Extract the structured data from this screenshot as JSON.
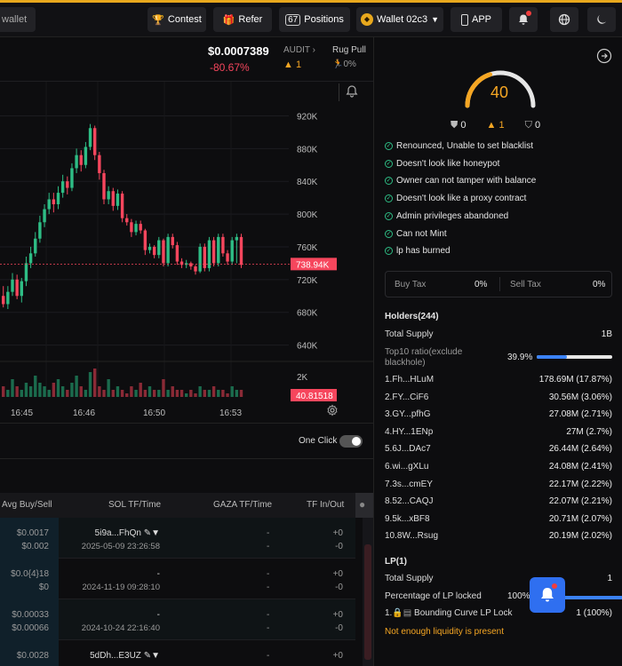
{
  "header": {
    "left_partial": "wallet",
    "contest": "Contest",
    "refer": "Refer",
    "positions_count": "67",
    "positions": "Positions",
    "wallet": "Wallet 02c3",
    "app": "APP",
    "contest_icon": "trophy-icon",
    "refer_icon": "gift-icon",
    "wallet_icon": "wallet-avatar-icon"
  },
  "price": {
    "value": "$0.0007389",
    "change": "-80.67%",
    "audit_label": "AUDIT",
    "audit_count": "1",
    "rugpull_label": "Rug Pull",
    "rugpull_value": "0%"
  },
  "chart_data": {
    "type": "candlestick",
    "y_ticks": [
      "920K",
      "880K",
      "840K",
      "800K",
      "760K",
      "720K",
      "680K",
      "640K"
    ],
    "ylim": [
      620000,
      940000
    ],
    "x_ticks": [
      "16:45",
      "16:46",
      "16:50",
      "16:53"
    ],
    "current_price_label": "738.94K",
    "current_price": 738940,
    "volume_tick": "2K",
    "volume_label": "40.81518",
    "candles": [
      [
        700000,
        690000,
        712000,
        686000
      ],
      [
        690000,
        705000,
        712000,
        684000
      ],
      [
        705000,
        720000,
        728000,
        700000
      ],
      [
        720000,
        700000,
        726000,
        696000
      ],
      [
        700000,
        718000,
        722000,
        692000
      ],
      [
        718000,
        740000,
        748000,
        712000
      ],
      [
        740000,
        752000,
        760000,
        734000
      ],
      [
        752000,
        770000,
        778000,
        748000
      ],
      [
        770000,
        790000,
        798000,
        765000
      ],
      [
        790000,
        806000,
        812000,
        784000
      ],
      [
        806000,
        818000,
        826000,
        800000
      ],
      [
        818000,
        812000,
        826000,
        802000
      ],
      [
        812000,
        826000,
        834000,
        806000
      ],
      [
        826000,
        840000,
        848000,
        820000
      ],
      [
        840000,
        832000,
        846000,
        824000
      ],
      [
        832000,
        856000,
        862000,
        828000
      ],
      [
        856000,
        872000,
        880000,
        850000
      ],
      [
        872000,
        860000,
        878000,
        852000
      ],
      [
        860000,
        882000,
        888000,
        856000
      ],
      [
        882000,
        905000,
        910000,
        878000
      ],
      [
        905000,
        872000,
        908000,
        866000
      ],
      [
        872000,
        850000,
        876000,
        842000
      ],
      [
        850000,
        818000,
        854000,
        812000
      ],
      [
        818000,
        828000,
        834000,
        812000
      ],
      [
        828000,
        810000,
        832000,
        804000
      ],
      [
        810000,
        825000,
        830000,
        805000
      ],
      [
        825000,
        795000,
        828000,
        790000
      ],
      [
        795000,
        790000,
        800000,
        786000
      ],
      [
        790000,
        778000,
        794000,
        772000
      ],
      [
        778000,
        788000,
        792000,
        774000
      ],
      [
        788000,
        780000,
        792000,
        776000
      ],
      [
        780000,
        756000,
        782000,
        750000
      ],
      [
        756000,
        760000,
        764000,
        752000
      ],
      [
        760000,
        750000,
        762000,
        746000
      ],
      [
        750000,
        768000,
        772000,
        746000
      ],
      [
        768000,
        740000,
        770000,
        736000
      ],
      [
        740000,
        772000,
        776000,
        736000
      ],
      [
        772000,
        762000,
        776000,
        758000
      ],
      [
        762000,
        742000,
        766000,
        738000
      ],
      [
        742000,
        738000,
        746000,
        734000
      ],
      [
        738000,
        740000,
        744000,
        734000
      ],
      [
        740000,
        736000,
        742000,
        732000
      ],
      [
        736000,
        730000,
        738000,
        726000
      ],
      [
        730000,
        760000,
        764000,
        728000
      ],
      [
        760000,
        734000,
        764000,
        730000
      ],
      [
        734000,
        768000,
        772000,
        730000
      ],
      [
        768000,
        740000,
        772000,
        736000
      ],
      [
        740000,
        772000,
        776000,
        736000
      ],
      [
        772000,
        752000,
        776000,
        748000
      ],
      [
        752000,
        742000,
        756000,
        738000
      ],
      [
        742000,
        768000,
        772000,
        738000
      ],
      [
        768000,
        772000,
        776000,
        740000
      ],
      [
        772000,
        738000,
        776000,
        734000
      ]
    ],
    "volumes": [
      3,
      2,
      5,
      3,
      2,
      4,
      3,
      6,
      4,
      3,
      2,
      4,
      5,
      3,
      2,
      4,
      6,
      3,
      2,
      7,
      8,
      3,
      2,
      5,
      2,
      3,
      2,
      1,
      3,
      2,
      4,
      2,
      3,
      2,
      2,
      5,
      2,
      3,
      2,
      2,
      1,
      2,
      1,
      3,
      2,
      2,
      3,
      2,
      2,
      1,
      3,
      2,
      2
    ]
  },
  "one_click": "One Click",
  "trades": {
    "headers": [
      "Avg Buy/Sell",
      "SOL TF/Time",
      "GAZA TF/Time",
      "TF In/Out"
    ],
    "rows": [
      {
        "avg_buy": "$0.0017",
        "avg_sell": "$0.002",
        "addr": "5i9a...FhQn",
        "time": "2025-05-09 23:26:58",
        "gaza": "-",
        "gaza2": "-",
        "tf_in": "+0",
        "tf_out": "-0"
      },
      {
        "avg_buy": "$0.0{4}18",
        "avg_sell": "$0",
        "addr": "-",
        "time": "2024-11-19 09:28:10",
        "gaza": "-",
        "gaza2": "-",
        "tf_in": "+0",
        "tf_out": "-0"
      },
      {
        "avg_buy": "$0.00033",
        "avg_sell": "$0.00066",
        "addr": "-",
        "time": "2024-10-24 22:16:40",
        "gaza": "-",
        "gaza2": "-",
        "tf_in": "+0",
        "tf_out": "-0"
      },
      {
        "avg_buy": "$0.0028",
        "avg_sell": "",
        "addr": "5dDh...E3UZ",
        "time": "",
        "gaza": "-",
        "gaza2": "",
        "tf_in": "+0",
        "tf_out": ""
      }
    ]
  },
  "audit": {
    "score": "40",
    "score_value": 40,
    "counts": {
      "safe": "0",
      "warn": "1",
      "unknown": "0"
    },
    "checks": [
      "Renounced, Unable to set blacklist",
      "Doesn't look like honeypot",
      "Owner can not tamper with balance",
      "Doesn't look like a proxy contract",
      "Admin privileges abandoned",
      "Can not Mint",
      "lp has burned"
    ],
    "buy_tax_label": "Buy Tax",
    "buy_tax": "0%",
    "sell_tax_label": "Sell Tax",
    "sell_tax": "0%"
  },
  "holders": {
    "title": "Holders(244)",
    "total_supply_label": "Total Supply",
    "total_supply": "1B",
    "top10_label_line1": "Top10 ratio(exclude",
    "top10_label_line2": "blackhole)",
    "top10_value": "39.9%",
    "top10_fraction": 0.399,
    "list": [
      {
        "name": "1.Fh...HLuM",
        "value": "178.69M (17.87%)"
      },
      {
        "name": "2.FY...CiF6",
        "value": "30.56M (3.06%)"
      },
      {
        "name": "3.GY...pfhG",
        "value": "27.08M (2.71%)"
      },
      {
        "name": "4.HY...1ENp",
        "value": "27M (2.7%)"
      },
      {
        "name": "5.6J...DAc7",
        "value": "26.44M (2.64%)"
      },
      {
        "name": "6.wi...gXLu",
        "value": "24.08M (2.41%)"
      },
      {
        "name": "7.3s...cmEY",
        "value": "22.17M (2.22%)"
      },
      {
        "name": "8.52...CAQJ",
        "value": "22.07M (2.21%)"
      },
      {
        "name": "9.5k...xBF8",
        "value": "20.71M (2.07%)"
      },
      {
        "name": "10.8W...Rsug",
        "value": "20.19M (2.02%)"
      }
    ]
  },
  "lp": {
    "title": "LP(1)",
    "total_supply_label": "Total Supply",
    "total_supply": "1",
    "locked_label": "Percentage of LP locked",
    "locked_value": "100%",
    "item_name": "Bounding Curve LP Lock",
    "item_value": "1 (100%)",
    "warning": "Not enough liquidity is present"
  }
}
